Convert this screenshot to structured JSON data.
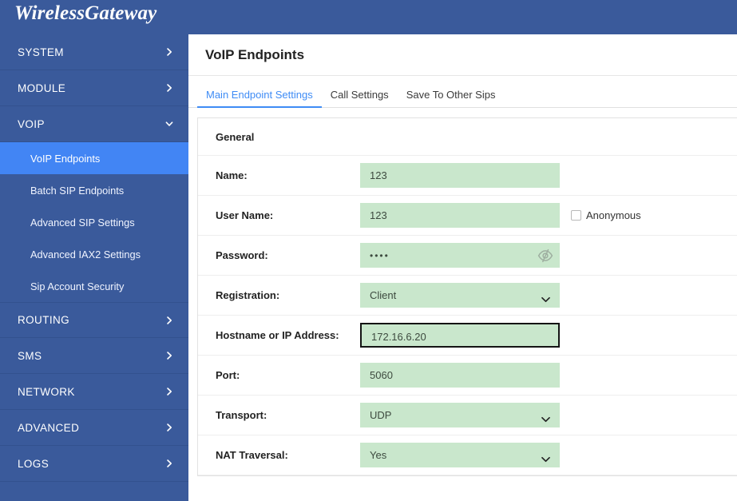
{
  "brand": {
    "title": "WirelessGateway"
  },
  "sidebar": {
    "groups": [
      {
        "label": "SYSTEM",
        "icon": "chevron-right-icon",
        "expanded": false
      },
      {
        "label": "MODULE",
        "icon": "chevron-right-icon",
        "expanded": false
      },
      {
        "label": "VOIP",
        "icon": "chevron-down-icon",
        "expanded": true
      }
    ],
    "voip_items": [
      {
        "label": "VoIP Endpoints",
        "active": true
      },
      {
        "label": "Batch SIP Endpoints",
        "active": false
      },
      {
        "label": "Advanced SIP Settings",
        "active": false
      },
      {
        "label": "Advanced IAX2 Settings",
        "active": false
      },
      {
        "label": "Sip Account Security",
        "active": false
      }
    ],
    "groups_lower": [
      {
        "label": "ROUTING",
        "icon": "chevron-right-icon"
      },
      {
        "label": "SMS",
        "icon": "chevron-right-icon"
      },
      {
        "label": "NETWORK",
        "icon": "chevron-right-icon"
      },
      {
        "label": "ADVANCED",
        "icon": "chevron-right-icon"
      },
      {
        "label": "LOGS",
        "icon": "chevron-right-icon"
      }
    ]
  },
  "page": {
    "title": "VoIP Endpoints",
    "tabs": [
      {
        "label": "Main Endpoint Settings",
        "active": true
      },
      {
        "label": "Call Settings",
        "active": false
      },
      {
        "label": "Save To Other Sips",
        "active": false
      }
    ]
  },
  "form": {
    "section_title": "General",
    "name": {
      "label": "Name:",
      "value": "123"
    },
    "user_name": {
      "label": "User Name:",
      "value": "123"
    },
    "anonymous": {
      "label": "Anonymous",
      "checked": false
    },
    "password": {
      "label": "Password:",
      "value": "••••",
      "toggle_icon": "eye-slash-icon"
    },
    "registration": {
      "label": "Registration:",
      "value": "Client",
      "caret_icon": "chevron-down-icon"
    },
    "hostname": {
      "label": "Hostname or IP Address:",
      "value": "172.16.6.20",
      "focused": true
    },
    "port": {
      "label": "Port:",
      "value": "5060"
    },
    "transport": {
      "label": "Transport:",
      "value": "UDP",
      "caret_icon": "chevron-down-icon"
    },
    "nat_traversal": {
      "label": "NAT Traversal:",
      "value": "Yes",
      "caret_icon": "chevron-down-icon"
    }
  },
  "colors": {
    "brand_blue": "#3a5a9b",
    "active_item_blue": "#4285f4",
    "tab_active_blue": "#3f8cf5",
    "field_green": "#c9e7cc"
  }
}
